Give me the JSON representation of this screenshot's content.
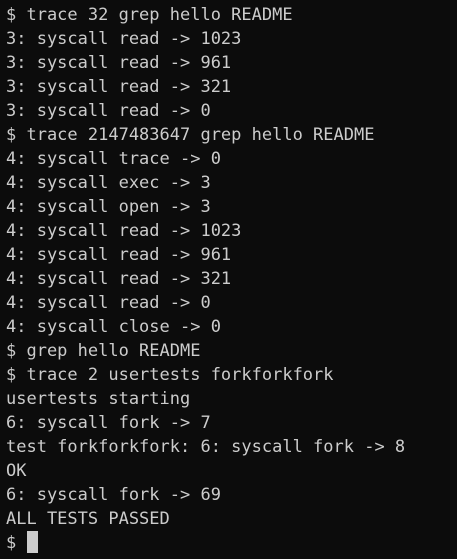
{
  "terminal": {
    "lines": [
      "$ trace 32 grep hello README",
      "3: syscall read -> 1023",
      "3: syscall read -> 961",
      "3: syscall read -> 321",
      "3: syscall read -> 0",
      "$ trace 2147483647 grep hello README",
      "4: syscall trace -> 0",
      "4: syscall exec -> 3",
      "4: syscall open -> 3",
      "4: syscall read -> 1023",
      "4: syscall read -> 961",
      "4: syscall read -> 321",
      "4: syscall read -> 0",
      "4: syscall close -> 0",
      "$ grep hello README",
      "$ trace 2 usertests forkforkfork",
      "usertests starting",
      "6: syscall fork -> 7",
      "test forkforkfork: 6: syscall fork -> 8",
      "OK",
      "6: syscall fork -> 69",
      "ALL TESTS PASSED"
    ],
    "prompt": "$ "
  }
}
